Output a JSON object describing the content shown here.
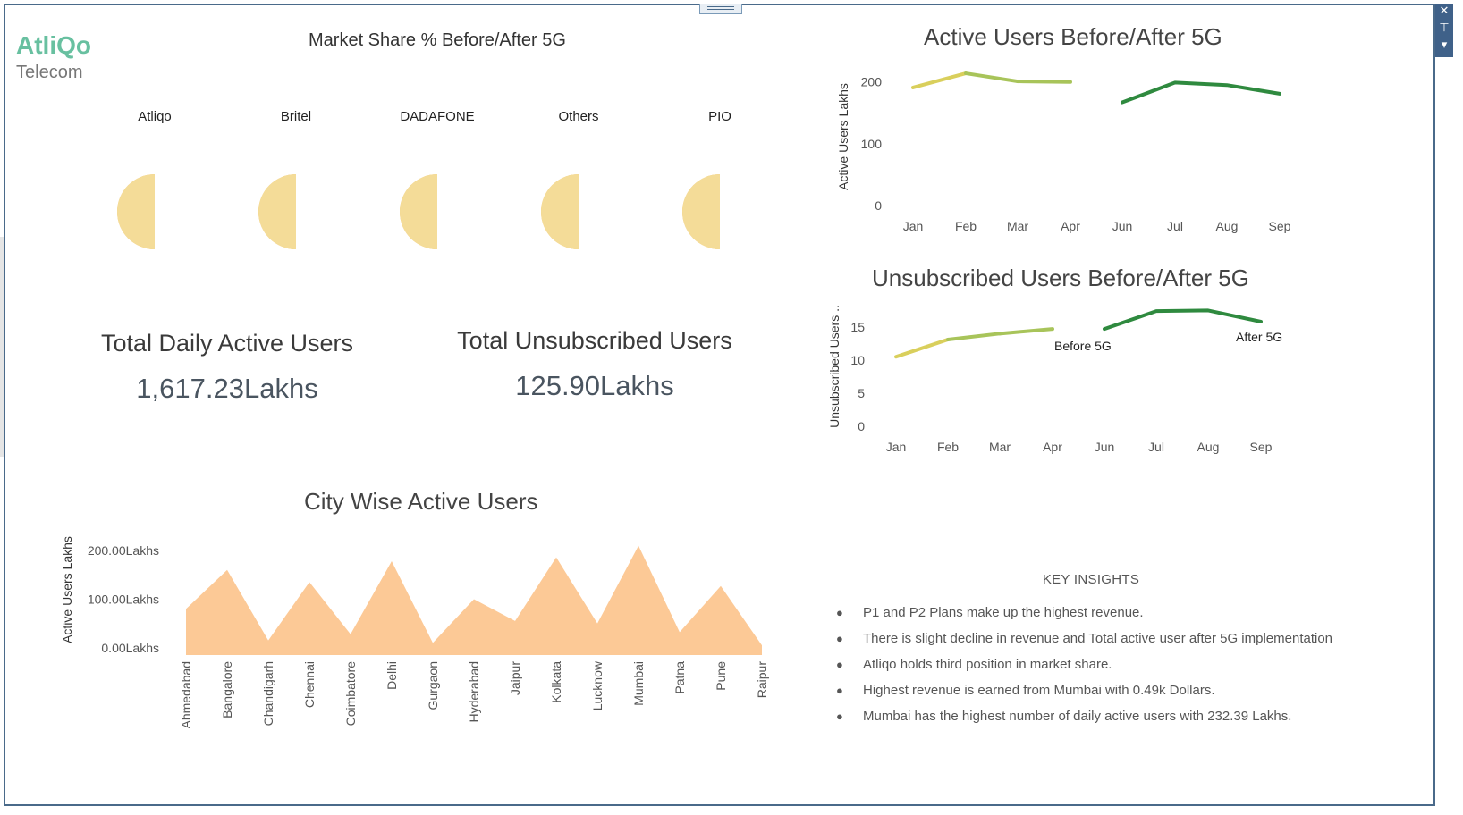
{
  "brand": {
    "name": "AtliQo",
    "subtitle": "Telecom"
  },
  "window": {
    "close_icon": "✕",
    "pin_icon": "⊤",
    "menu_icon": "▾"
  },
  "kpis": {
    "daily_label": "Total Daily Active Users",
    "daily_value": "1,617.23Lakhs",
    "unsub_label": "Total Unsubscribed Users",
    "unsub_value": "125.90Lakhs"
  },
  "insights": {
    "title": "KEY INSIGHTS",
    "items": [
      "P1 and P2 Plans make up the highest revenue.",
      "There is slight decline in revenue and Total active user after 5G implementation",
      "Atliqo holds third position in market share.",
      "Highest revenue is earned from Mumbai with 0.49k Dollars.",
      "Mumbai has the highest number of daily active users with 232.39 Lakhs."
    ]
  },
  "colors": {
    "before": "#d9cf5c",
    "before_mid": "#a8c45a",
    "after": "#2f8a3f",
    "pie_before": "#f2bf66",
    "pie_after": "#f4dc98",
    "area": "#fcc996",
    "brand": "#68c0a0"
  },
  "chart_data": [
    {
      "type": "pie",
      "title": "Market Share % Before/After 5G",
      "categories": [
        "Atliqo",
        "Britel",
        "DADAFONE",
        "Others",
        "PIO"
      ],
      "series": [
        {
          "values": [
            50,
            50,
            50,
            50,
            50
          ]
        },
        {
          "values": [
            50,
            50,
            50,
            50,
            50
          ]
        }
      ]
    },
    {
      "type": "line",
      "title": "Active Users Before/After 5G",
      "ylabel": "Active Users Lakhs",
      "categories": [
        "Jan",
        "Feb",
        "Mar",
        "Apr",
        "Jun",
        "Jul",
        "Aug",
        "Sep"
      ],
      "yticks": [
        0,
        100,
        200
      ],
      "ylim": [
        0,
        230
      ],
      "series": [
        {
          "x": [
            "Jan",
            "Feb",
            "Mar",
            "Apr"
          ],
          "values": [
            191,
            214,
            201,
            200
          ]
        },
        {
          "x": [
            "Jun",
            "Jul",
            "Aug",
            "Sep"
          ],
          "values": [
            167,
            199,
            195,
            181
          ]
        }
      ]
    },
    {
      "type": "line",
      "title": "Unsubscribed Users Before/After 5G",
      "ylabel": "Unsubscribed Users ..",
      "categories": [
        "Jan",
        "Feb",
        "Mar",
        "Apr",
        "Jun",
        "Jul",
        "Aug",
        "Sep"
      ],
      "yticks": [
        0,
        5,
        10,
        15
      ],
      "ylim": [
        0,
        18.5
      ],
      "series": [
        {
          "name": "Before 5G",
          "x": [
            "Jan",
            "Feb",
            "Mar",
            "Apr"
          ],
          "values": [
            10.5,
            13.1,
            14,
            14.7
          ]
        },
        {
          "name": "After 5G",
          "x": [
            "Jun",
            "Jul",
            "Aug",
            "Sep"
          ],
          "values": [
            14.7,
            17.4,
            17.5,
            15.8
          ]
        }
      ]
    },
    {
      "type": "area",
      "title": "City Wise Active Users",
      "ylabel": "Active Users Lakhs",
      "ytick_labels": [
        "0.00Lakhs",
        "100.00Lakhs",
        "200.00Lakhs"
      ],
      "yticks": [
        0,
        100,
        200
      ],
      "ylim": [
        -15,
        235
      ],
      "categories": [
        "Ahmedabad",
        "Bangalore",
        "Chandigarh",
        "Chennai",
        "Coimbatore",
        "Delhi",
        "Gurgaon",
        "Hyderabad",
        "Jaipur",
        "Kolkata",
        "Lucknow",
        "Mumbai",
        "Patna",
        "Pune",
        "Raipur"
      ],
      "values": [
        80,
        160,
        15,
        135,
        28,
        178,
        10,
        100,
        55,
        186,
        50,
        210,
        32,
        127,
        5
      ]
    }
  ]
}
